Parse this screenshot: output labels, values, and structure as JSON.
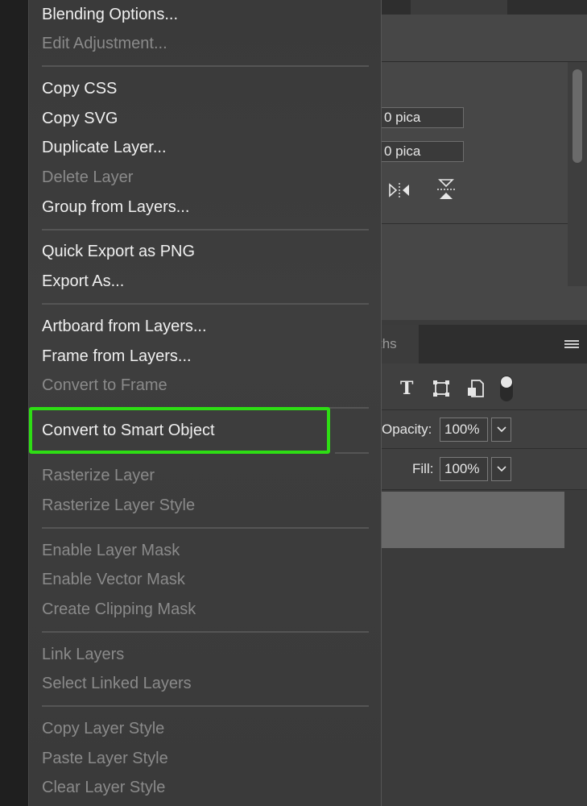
{
  "panels": {
    "properties": {
      "field_1_value": "0 pica",
      "field_2_value": "0 pica"
    },
    "layers": {
      "tab_label": "ths",
      "opacity_label": "Opacity:",
      "opacity_value": "100%",
      "fill_label": "Fill:",
      "fill_value": "100%"
    }
  },
  "context_menu": {
    "items": [
      {
        "label": "Blending Options...",
        "enabled": true
      },
      {
        "label": "Edit Adjustment...",
        "enabled": false
      },
      {
        "label": "Copy CSS",
        "enabled": true
      },
      {
        "label": "Copy SVG",
        "enabled": true
      },
      {
        "label": "Duplicate Layer...",
        "enabled": true
      },
      {
        "label": "Delete Layer",
        "enabled": false
      },
      {
        "label": "Group from Layers...",
        "enabled": true
      },
      {
        "label": "Quick Export as PNG",
        "enabled": true
      },
      {
        "label": "Export As...",
        "enabled": true
      },
      {
        "label": "Artboard from Layers...",
        "enabled": true
      },
      {
        "label": "Frame from Layers...",
        "enabled": true
      },
      {
        "label": "Convert to Frame",
        "enabled": false
      },
      {
        "label": "Convert to Smart Object",
        "enabled": true
      },
      {
        "label": "Rasterize Layer",
        "enabled": false
      },
      {
        "label": "Rasterize Layer Style",
        "enabled": false
      },
      {
        "label": "Enable Layer Mask",
        "enabled": false
      },
      {
        "label": "Enable Vector Mask",
        "enabled": false
      },
      {
        "label": "Create Clipping Mask",
        "enabled": false
      },
      {
        "label": "Link Layers",
        "enabled": false
      },
      {
        "label": "Select Linked Layers",
        "enabled": false
      },
      {
        "label": "Copy Layer Style",
        "enabled": false
      },
      {
        "label": "Paste Layer Style",
        "enabled": false
      },
      {
        "label": "Clear Layer Style",
        "enabled": false
      }
    ],
    "highlight_color": "#2ede14"
  }
}
